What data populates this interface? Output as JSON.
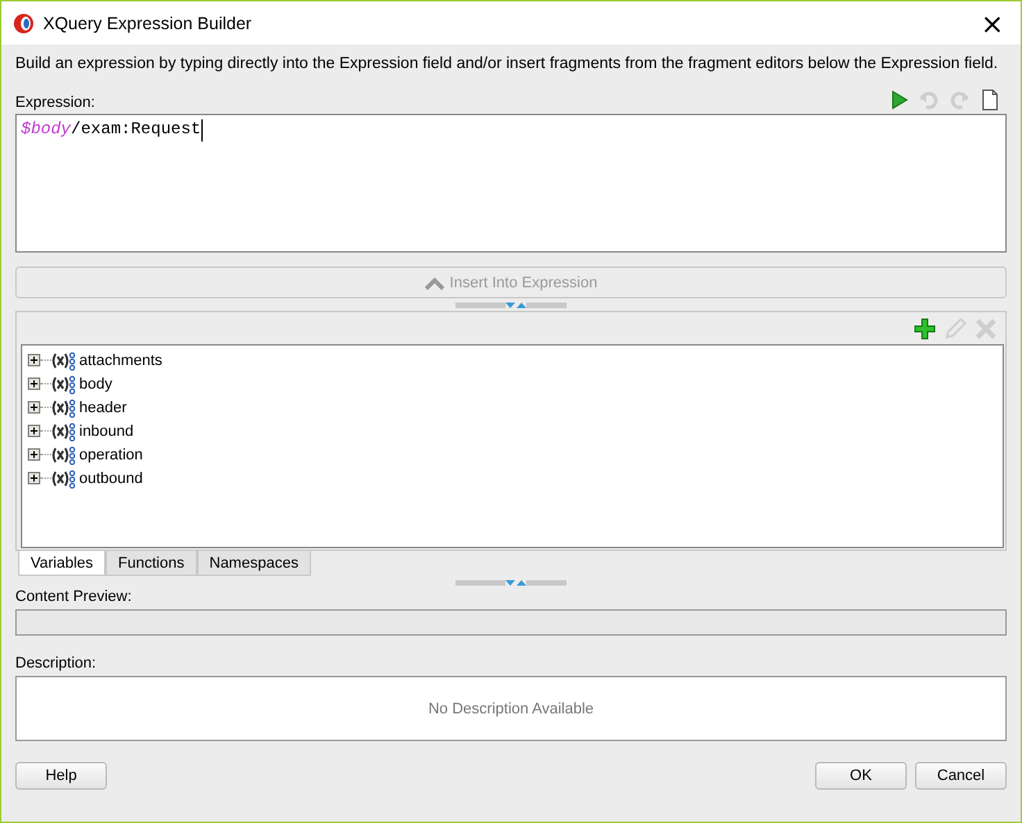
{
  "window": {
    "title": "XQuery Expression Builder",
    "close": "×"
  },
  "instructions": "Build an expression by typing directly into the Expression field and/or insert fragments from the fragment editors below the Expression field.",
  "expression": {
    "label": "Expression:",
    "tokens": [
      {
        "kind": "variable",
        "text": "$body"
      },
      {
        "kind": "path",
        "text": "/exam:Request"
      }
    ],
    "toolbar": [
      {
        "kind": "run",
        "disabled": false
      },
      {
        "kind": "undo",
        "disabled": true
      },
      {
        "kind": "redo",
        "disabled": true
      },
      {
        "kind": "clear",
        "disabled": false
      }
    ]
  },
  "insert_button": {
    "label": "Insert Into Expression",
    "disabled": true
  },
  "fragment_toolbar": [
    {
      "kind": "add",
      "disabled": false
    },
    {
      "kind": "edit",
      "disabled": true
    },
    {
      "kind": "delete",
      "disabled": true
    }
  ],
  "tree": [
    {
      "label": "attachments",
      "expanded": false
    },
    {
      "label": "body",
      "expanded": false
    },
    {
      "label": "header",
      "expanded": false
    },
    {
      "label": "inbound",
      "expanded": false
    },
    {
      "label": "operation",
      "expanded": false
    },
    {
      "label": "outbound",
      "expanded": false
    }
  ],
  "tabs": [
    {
      "label": "Variables",
      "selected": true
    },
    {
      "label": "Functions",
      "selected": false
    },
    {
      "label": "Namespaces",
      "selected": false
    }
  ],
  "content_preview": {
    "label": "Content Preview:"
  },
  "description": {
    "label": "Description:",
    "text": "No Description Available"
  },
  "buttons": {
    "help": "Help",
    "ok": "OK",
    "cancel": "Cancel"
  }
}
